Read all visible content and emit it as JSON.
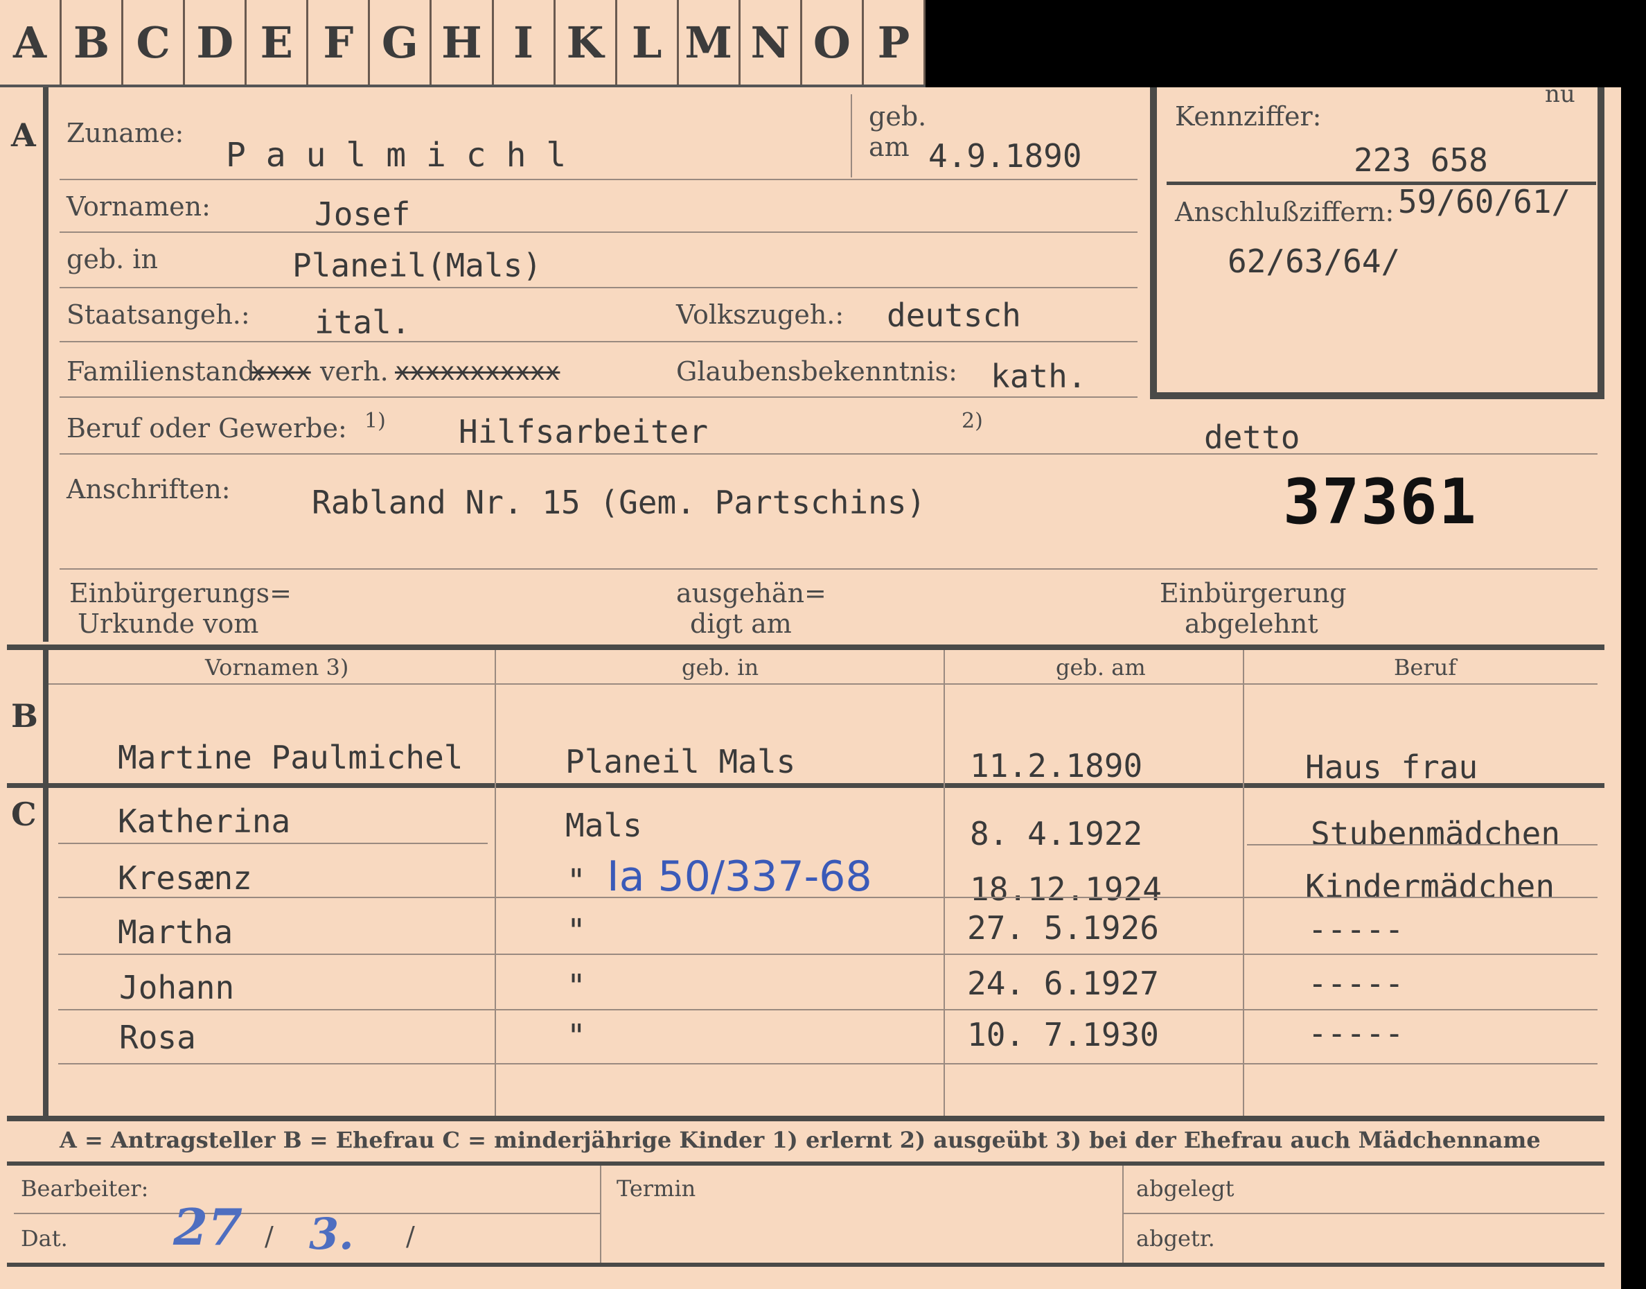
{
  "tabs": [
    "A",
    "B",
    "C",
    "D",
    "E",
    "F",
    "G",
    "H",
    "I",
    "K",
    "L",
    "M",
    "N",
    "O",
    "P"
  ],
  "corner_mark": "nu",
  "section_letters": {
    "a": "A",
    "b": "B",
    "c": "C"
  },
  "labels": {
    "zuname": "Zuname:",
    "geb": "geb.",
    "am": "am",
    "vornamen": "Vornamen:",
    "geb_in": "geb. in",
    "staatsangeh": "Staatsangeh.:",
    "volkszugeh": "Volkszugeh.:",
    "familienstand": "Familienstand:",
    "familienstand_verh": "verh.",
    "glaubensbekenntnis": "Glaubensbekenntnis:",
    "beruf": "Beruf oder Gewerbe:",
    "note1": "1)",
    "note2": "2)",
    "anschriften": "Anschriften:",
    "einbuergerungs_1": "Einbürgerungs=",
    "einbuergerungs_2": "Urkunde vom",
    "ausgehaen_1": "ausgehän=",
    "ausgehaen_2": "digt am",
    "abgelehnt_1": "Einbürgerung",
    "abgelehnt_2": "abgelehnt",
    "kennziffer": "Kennziffer:",
    "anschluss": "Anschlußziffern:"
  },
  "applicant": {
    "zuname": "P a u l m i c h l",
    "geb_am": "4.9.1890",
    "vornamen": "Josef",
    "geb_in": "Planeil(Mals)",
    "staatsangeh": "ital.",
    "volkszugeh": "deutsch",
    "familienstand_struck_1": "xxxx",
    "familienstand_struck_2": "xxxxxxxxxxx",
    "glaubensbekenntnis": "kath.",
    "beruf_erlernt": "Hilfsarbeiter",
    "beruf_ausgeuebt": "detto",
    "anschrift": "Rabland Nr. 15  (Gem. Partschins)",
    "stamp_number": "37361"
  },
  "kennziffer": "223  658",
  "anschluss_1": "59/60/61/",
  "anschluss_2": "62/63/64/",
  "table": {
    "headers": [
      "Vornamen 3)",
      "geb. in",
      "geb. am",
      "Beruf"
    ],
    "spouse": {
      "vornamen": "Martine Paulmichel",
      "geb_in": "Planeil Mals",
      "geb_am": "11.2.1890",
      "beruf": "Haus frau"
    },
    "children": [
      {
        "vornamen": "Katherina",
        "geb_in": "Mals",
        "geb_am": "8. 4.1922",
        "beruf": "Stubenmädchen"
      },
      {
        "vornamen": "Kresænz",
        "geb_in": "\"",
        "geb_am": "18.12.1924",
        "beruf": "Kindermädchen"
      },
      {
        "vornamen": "Martha",
        "geb_in": "\"",
        "geb_am": "27. 5.1926",
        "beruf": "-----"
      },
      {
        "vornamen": "Johann",
        "geb_in": "\"",
        "geb_am": "24. 6.1927",
        "beruf": "-----"
      },
      {
        "vornamen": "Rosa",
        "geb_in": "\"",
        "geb_am": "10. 7.1930",
        "beruf": "-----"
      }
    ],
    "handwritten_ref": "Ia 50/337-68"
  },
  "legend": "A = Antragsteller   B = Ehefrau   C = minderjährige Kinder   1) erlernt   2) ausgeübt   3) bei der Ehefrau auch Mädchenname",
  "footer": {
    "bearbeiter": "Bearbeiter:",
    "termin": "Termin",
    "abgelegt": "abgelegt",
    "dat": "Dat.",
    "abgetr": "abgetr.",
    "date_day": "27",
    "date_month": "3.",
    "slash": "/"
  }
}
